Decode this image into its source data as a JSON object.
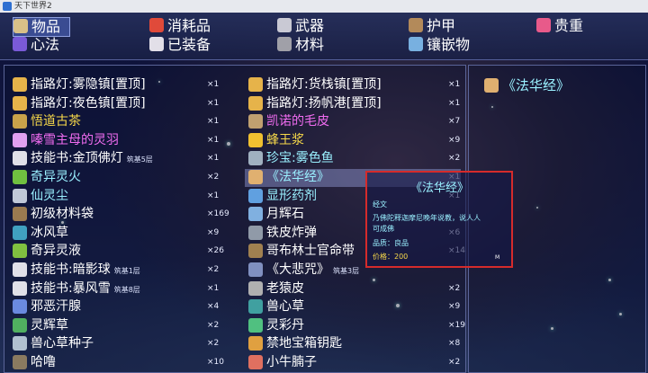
{
  "window": {
    "title": "天下世界2"
  },
  "tabs": [
    {
      "label": "物品",
      "icon": "bag-icon",
      "color": "#d8c088",
      "active": true
    },
    {
      "label": "消耗品",
      "icon": "potion-icon",
      "color": "#e04a3a"
    },
    {
      "label": "武器",
      "icon": "sword-icon",
      "color": "#c9c9d4"
    },
    {
      "label": "护甲",
      "icon": "armor-icon",
      "color": "#b38a5a"
    },
    {
      "label": "贵重",
      "icon": "gem-icon",
      "color": "#e85a8a"
    },
    {
      "label": "心法",
      "icon": "book-icon",
      "color": "#7a5ad8"
    },
    {
      "label": "已装备",
      "icon": "equipped-icon",
      "color": "#e2dfe8"
    },
    {
      "label": "材料",
      "icon": "material-icon",
      "color": "#a0a0a8"
    },
    {
      "label": "镶嵌物",
      "icon": "socket-gem-icon",
      "color": "#78b0e0"
    }
  ],
  "items_left": [
    {
      "name": "指路灯:雾隐镇[置顶]",
      "count": "×1",
      "color": "#ffffff",
      "icon": "lamp-icon",
      "icon_color": "#e6b34a"
    },
    {
      "name": "指路灯:夜色镇[置顶]",
      "count": "×1",
      "color": "#ffffff",
      "icon": "lamp-icon",
      "icon_color": "#e6b34a"
    },
    {
      "name": "悟道古茶",
      "count": "×1",
      "color": "#f7d94a",
      "icon": "tea-icon",
      "icon_color": "#c9a24a"
    },
    {
      "name": "嗪雪主母的灵羽",
      "count": "×1",
      "color": "#f06cf0",
      "icon": "feather-icon",
      "icon_color": "#e0a0f0"
    },
    {
      "name": "技能书:金顶佛灯",
      "sub": "筑基5层",
      "count": "×1",
      "color": "#ffffff",
      "icon": "skillbook-icon",
      "icon_color": "#e0e0e8"
    },
    {
      "name": "奇异灵火",
      "count": "×2",
      "color": "#9af0ff",
      "icon": "fire-icon",
      "icon_color": "#70c040"
    },
    {
      "name": "仙灵尘",
      "count": "×1",
      "color": "#9af0ff",
      "icon": "dust-icon",
      "icon_color": "#c0c8d8"
    },
    {
      "name": "初级材料袋",
      "count": "×169",
      "color": "#ffffff",
      "icon": "bag-icon",
      "icon_color": "#9a7a50"
    },
    {
      "name": "冰风草",
      "count": "×9",
      "color": "#ffffff",
      "icon": "herb-icon",
      "icon_color": "#40a0c0"
    },
    {
      "name": "奇异灵液",
      "count": "×26",
      "color": "#ffffff",
      "icon": "liquid-icon",
      "icon_color": "#80c040"
    },
    {
      "name": "技能书:暗影球",
      "sub": "筑基1层",
      "count": "×2",
      "color": "#ffffff",
      "icon": "skillbook-icon",
      "icon_color": "#e0e0e8"
    },
    {
      "name": "技能书:暴风雪",
      "sub": "筑基8层",
      "count": "×1",
      "color": "#ffffff",
      "icon": "skillbook-icon",
      "icon_color": "#e0e0e8"
    },
    {
      "name": "邪恶汗腺",
      "count": "×4",
      "color": "#ffffff",
      "icon": "gland-icon",
      "icon_color": "#6a8ae0"
    },
    {
      "name": "灵辉草",
      "count": "×2",
      "color": "#ffffff",
      "icon": "herb-icon",
      "icon_color": "#50b060"
    },
    {
      "name": "兽心草种子",
      "count": "×2",
      "color": "#ffffff",
      "icon": "seed-icon",
      "icon_color": "#b0c0d0"
    },
    {
      "name": "哈噜",
      "count": "×10",
      "color": "#ffffff",
      "icon": "item-icon",
      "icon_color": "#8a7a60"
    }
  ],
  "items_mid": [
    {
      "name": "指路灯:货栈镇[置顶]",
      "count": "×1",
      "color": "#ffffff",
      "icon": "lamp-icon",
      "icon_color": "#e6b34a"
    },
    {
      "name": "指路灯:扬帆港[置顶]",
      "count": "×1",
      "color": "#ffffff",
      "icon": "lamp-icon",
      "icon_color": "#e6b34a"
    },
    {
      "name": "凯诺的毛皮",
      "count": "×7",
      "color": "#f06cf0",
      "icon": "fur-icon",
      "icon_color": "#c0a070"
    },
    {
      "name": "蜂王浆",
      "count": "×9",
      "color": "#f7d94a",
      "icon": "jelly-icon",
      "icon_color": "#f0c030"
    },
    {
      "name": "珍宝:雾色鱼",
      "count": "×2",
      "color": "#9af0ff",
      "icon": "fish-icon",
      "icon_color": "#a0b0c0"
    },
    {
      "name": "《法华经》",
      "count": "×1",
      "color": "#9af0ff",
      "icon": "scripture-icon",
      "icon_color": "#e0b070",
      "selected": true
    },
    {
      "name": "显形药剂",
      "count": "×1",
      "color": "#9af0ff",
      "icon": "potion-icon",
      "icon_color": "#60a0e0"
    },
    {
      "name": "月辉石",
      "count": "",
      "color": "#ffffff",
      "icon": "stone-icon",
      "icon_color": "#80b0e0"
    },
    {
      "name": "铁皮炸弹",
      "count": "×6",
      "color": "#ffffff",
      "icon": "bomb-icon",
      "icon_color": "#909aa8"
    },
    {
      "name": "哥布林士官命带",
      "count": "×14",
      "color": "#ffffff",
      "icon": "belt-icon",
      "icon_color": "#a08050"
    },
    {
      "name": "《大悲咒》",
      "sub": "筑基3层",
      "count": "",
      "color": "#ffffff",
      "icon": "scripture-icon",
      "icon_color": "#8090c0"
    },
    {
      "name": "老猿皮",
      "count": "×2",
      "color": "#ffffff",
      "icon": "fur-icon",
      "icon_color": "#b0b0b0"
    },
    {
      "name": "兽心草",
      "count": "×9",
      "color": "#ffffff",
      "icon": "herb-icon",
      "icon_color": "#40a0a0"
    },
    {
      "name": "灵彩丹",
      "count": "×19",
      "color": "#ffffff",
      "icon": "pill-icon",
      "icon_color": "#50c080"
    },
    {
      "name": "禁地宝箱钥匙",
      "count": "×8",
      "color": "#ffffff",
      "icon": "key-icon",
      "icon_color": "#e0a040"
    },
    {
      "name": "小牛腩子",
      "count": "×2",
      "color": "#ffffff",
      "icon": "meat-icon",
      "icon_color": "#e07060"
    }
  ],
  "detail": {
    "name": "《法华经》",
    "icon": "scripture-icon",
    "icon_color": "#e0b070",
    "color": "#9af0ff"
  },
  "tooltip": {
    "title": "《法华经》",
    "type": "经文",
    "desc1": "乃佛陀释迦摩尼晚年说教，说人人",
    "desc2": "可成佛",
    "quality": "品质：良品",
    "price": "价格：200",
    "corner": "M",
    "border_color": "#d52b2b"
  }
}
